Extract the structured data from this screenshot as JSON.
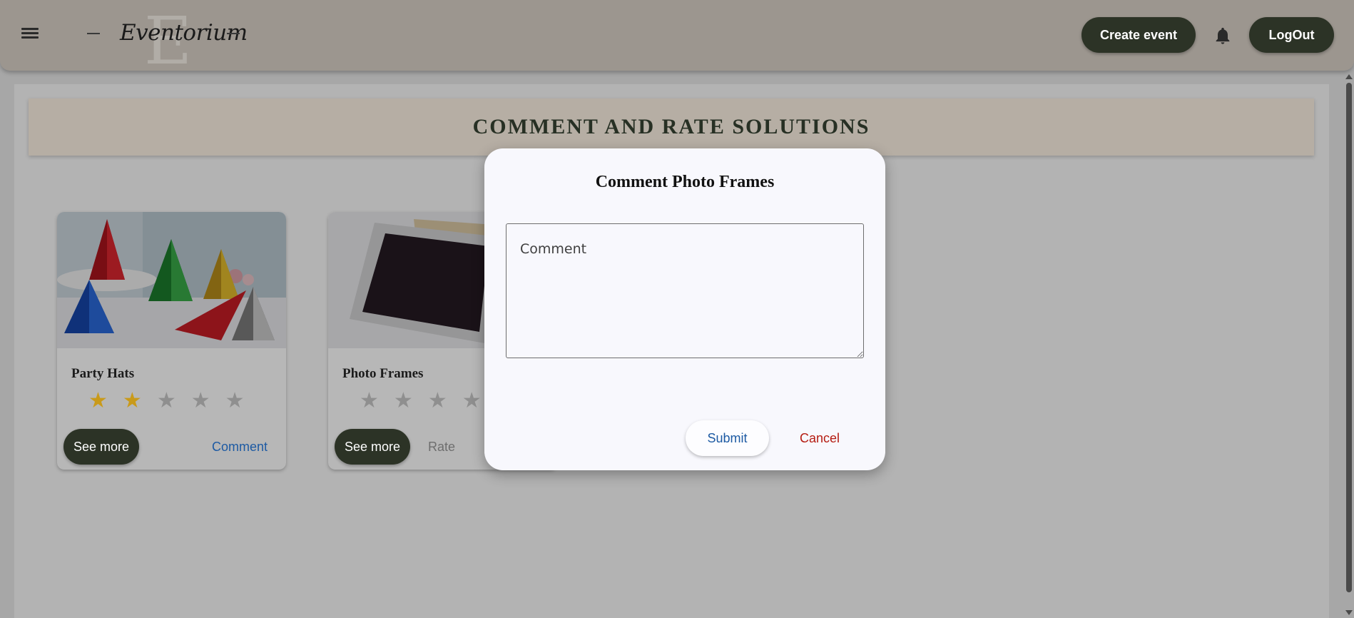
{
  "header": {
    "logo_text": "Eventorium",
    "logo_letter": "E",
    "create_event_label": "Create event",
    "logout_label": "LogOut",
    "icons": [
      "menu-icon",
      "bell-icon"
    ]
  },
  "page": {
    "title": "COMMENT AND RATE SOLUTIONS"
  },
  "cards": [
    {
      "title": "Party Hats",
      "rating": 2,
      "max_rating": 5,
      "see_more_label": "See more",
      "action_label": "Comment"
    },
    {
      "title": "Photo Frames",
      "rating": 0,
      "max_rating": 5,
      "see_more_label": "See more",
      "action_label": "Rate"
    }
  ],
  "modal": {
    "title": "Comment Photo Frames",
    "comment_placeholder": "Comment",
    "comment_value": "",
    "submit_label": "Submit",
    "cancel_label": "Cancel"
  },
  "colors": {
    "primary_dark": "#2c3326",
    "link_blue": "#1d5aa3",
    "cancel_red": "#b51c12",
    "star_gold": "#c99a1a"
  }
}
